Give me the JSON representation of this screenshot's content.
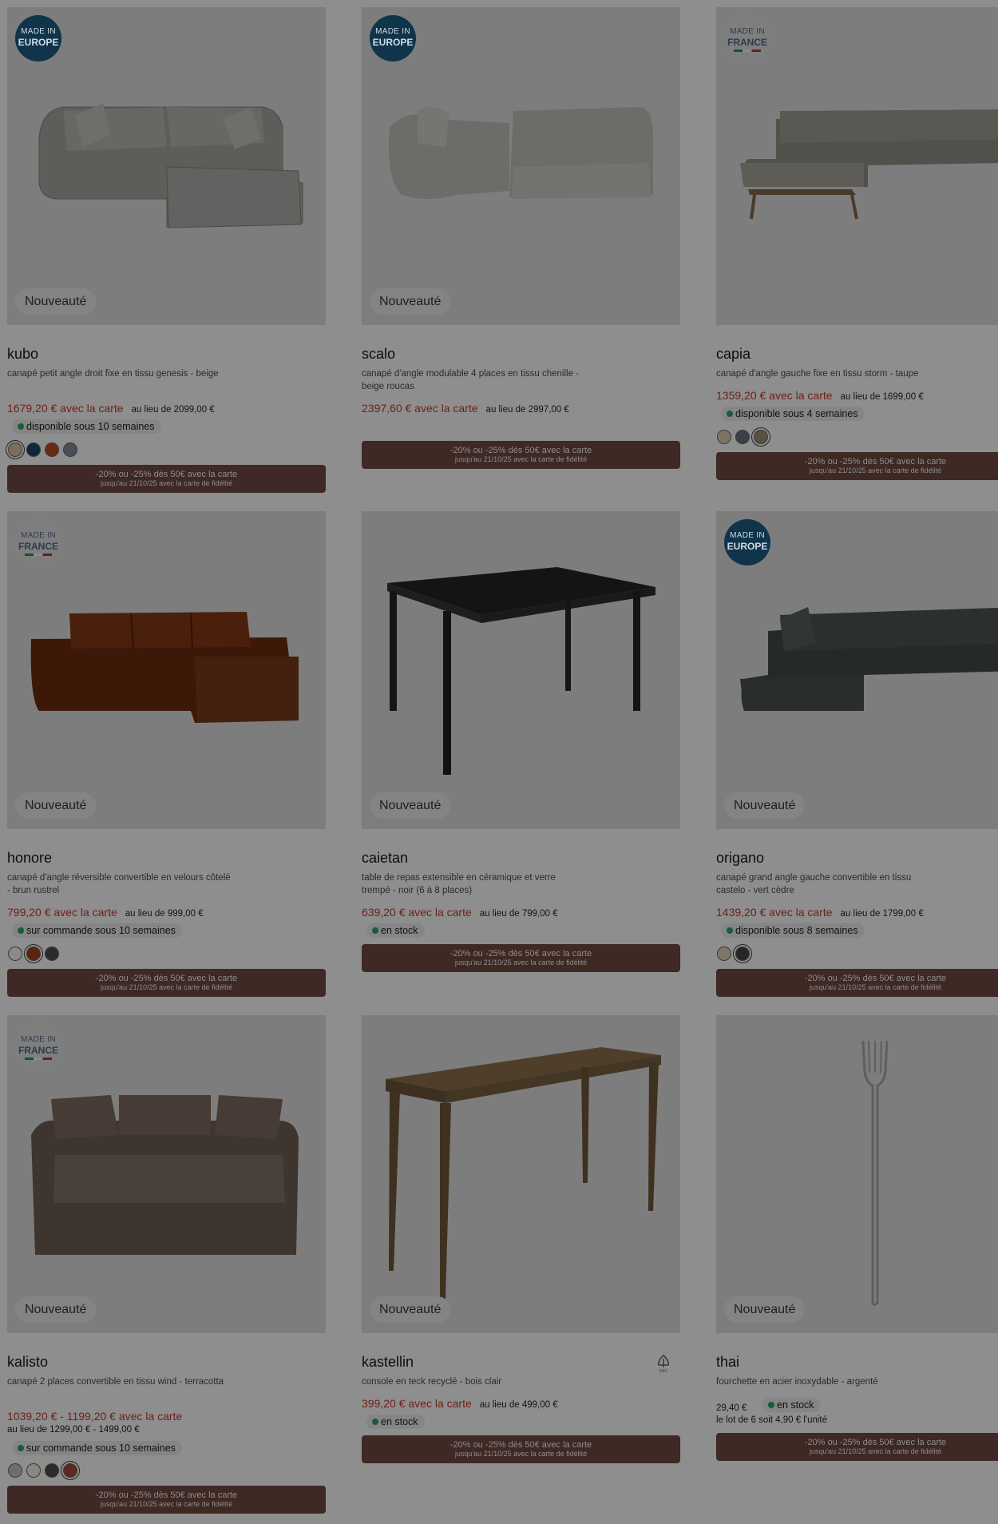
{
  "colors": {
    "price": "#6e1f18",
    "promo_bg": "#3e2924",
    "stock_dot": "#1d5a36",
    "overlay": "#8e8e8e"
  },
  "products": [
    {
      "name": "kubo",
      "badge": {
        "type": "europe",
        "line1": "MADE IN",
        "line2": "EUROPE"
      },
      "new_tag": "Nouveauté",
      "description": "canapé petit angle droit fixe en tissu genesis - beige",
      "price": "1679,20 € avec la carte",
      "was_price": "au lieu de 2099,00 €",
      "availability": "disponible sous 10 semaines",
      "swatches": [
        "#7a6f5c",
        "#0e2838",
        "#6a2a10",
        "#4a4f55"
      ],
      "promo": {
        "line1": "-20% ou -25% dès 50€ avec la carte",
        "line2": "jusqu'au 21/10/25 avec la carte de fidélité"
      }
    },
    {
      "name": "scalo",
      "badge": {
        "type": "europe",
        "line1": "MADE IN",
        "line2": "EUROPE"
      },
      "new_tag": "Nouveauté",
      "description": "canapé d'angle modulable 4 places en tissu chenille - beige roucas",
      "price": "2397,60 € avec la carte",
      "was_price": "au lieu de 2997,00 €",
      "promo": {
        "line1": "-20% ou -25% dès 50€ avec la carte",
        "line2": "jusqu'au 21/10/25 avec la carte de fidélité"
      }
    },
    {
      "name": "capia",
      "badge": {
        "type": "france",
        "line1": "MADE IN",
        "line2": "FRANCE"
      },
      "description": "canapé d'angle gauche fixe en tissu storm - taupe",
      "price": "1359,20 € avec la carte",
      "was_price": "au lieu de 1699,00 €",
      "availability": "disponible sous 4 semaines",
      "swatches": [
        "#7e7462",
        "#3a3f4a",
        "#5a5043"
      ],
      "promo": {
        "line1": "-20% ou -25% dès 50€ avec la carte",
        "line2": "jusqu'au 21/10/25 avec la carte de fidélité"
      }
    },
    {
      "name": "honore",
      "badge": {
        "type": "france",
        "line1": "MADE IN",
        "line2": "FRANCE"
      },
      "new_tag": "Nouveauté",
      "description": "canapé d'angle réversible convertible en velours côtelé - brun rustrel",
      "price": "799,20 € avec la carte",
      "was_price": "au lieu de 999,00 €",
      "availability": "sur commande sous 10 semaines",
      "swatches": [
        "#8c8a86",
        "#5a240e",
        "#2a2b2c"
      ],
      "promo": {
        "line1": "-20% ou -25% dès 50€ avec la carte",
        "line2": "jusqu'au 21/10/25 avec la carte de fidélité"
      }
    },
    {
      "name": "caietan",
      "new_tag": "Nouveauté",
      "description": "table de repas extensible en céramique et verre trempé - noir (6 à 8 places)",
      "price": "639,20 € avec la carte",
      "was_price": "au lieu de 799,00 €",
      "availability": "en stock",
      "promo": {
        "line1": "-20% ou -25% dès 50€ avec la carte",
        "line2": "jusqu'au 21/10/25 avec la carte de fidélité"
      }
    },
    {
      "name": "origano",
      "badge": {
        "type": "europe",
        "line1": "MADE IN",
        "line2": "EUROPE"
      },
      "new_tag": "Nouveauté",
      "description": "canapé grand angle gauche convertible en tissu castelo - vert cèdre",
      "price": "1439,20 € avec la carte",
      "was_price": "au lieu de 1799,00 €",
      "availability": "disponible sous 8 semaines",
      "swatches": [
        "#7e7668",
        "#25282a"
      ],
      "promo": {
        "line1": "-20% ou -25% dès 50€ avec la carte",
        "line2": "jusqu'au 21/10/25 avec la carte de fidélité"
      }
    },
    {
      "name": "kalisto",
      "badge": {
        "type": "france",
        "line1": "MADE IN",
        "line2": "FRANCE"
      },
      "new_tag": "Nouveauté",
      "description": "canapé 2 places convertible en tissu wind - terracotta",
      "price": "1039,20 € - 1199,20 € avec la carte",
      "was_price": "au lieu de 1299,00 € - 1499,00 €",
      "availability": "sur commande sous 10 semaines",
      "swatches": [
        "#6e6e6e",
        "#8a877e",
        "#2a2a2a",
        "#5a2a22"
      ],
      "promo": {
        "line1": "-20% ou -25% dès 50€ avec la carte",
        "line2": "jusqu'au 21/10/25 avec la carte de fidélité"
      }
    },
    {
      "name": "kastellin",
      "new_tag": "Nouveauté",
      "description": "console en teck recyclé - bois clair",
      "price": "399,20 € avec la carte",
      "was_price": "au lieu de 499,00 €",
      "availability": "en stock",
      "promo": {
        "line1": "-20% ou -25% dès 50€ avec la carte",
        "line2": "jusqu'au 21/10/25 avec la carte de fidélité"
      }
    },
    {
      "name": "thai",
      "new_tag": "Nouveauté",
      "description": "fourchette en acier inoxydable - argenté",
      "price": "29,40 €",
      "availability": "en stock",
      "lot_text": "le lot de 6 soit 4,90 € l'unité",
      "promo": {
        "line1": "-20% ou -25% dès 50€ avec la carte",
        "line2": "jusqu'au 21/10/25 avec la carte de fidélité"
      }
    }
  ]
}
